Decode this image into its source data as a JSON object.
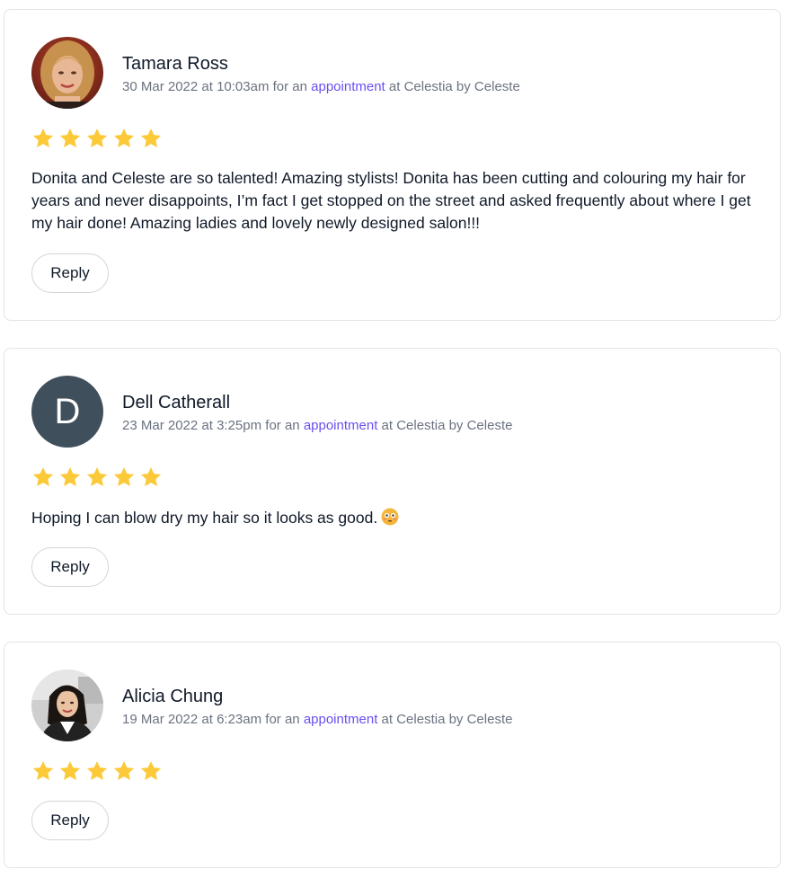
{
  "reviews": [
    {
      "name": "Tamara Ross",
      "avatar": {
        "type": "photo",
        "description_icon": "user-photo"
      },
      "date": "30 Mar 2022 at 10:03am",
      "for_text": " for an ",
      "link_text": "appointment",
      "at_text": " at Celestia by Celeste",
      "rating": 5,
      "text": "Donita and Celeste are so talented! Amazing stylists! Donita has been cutting and  colouring my hair for years and never disappoints, I’m fact I get  stopped on the street and asked frequently about where I get my hair done!  Amazing ladies and lovely newly designed salon!!!",
      "reply_label": "Reply"
    },
    {
      "name": "Dell Catherall",
      "avatar": {
        "type": "letter",
        "letter": "D",
        "bg": "#3f4f5b"
      },
      "date": "23 Mar 2022 at 3:25pm",
      "for_text": " for an ",
      "link_text": "appointment",
      "at_text": " at Celestia by Celeste",
      "rating": 5,
      "text": "Hoping I can blow dry my hair so it looks as good.",
      "emoji": "flushed-face-icon",
      "reply_label": "Reply"
    },
    {
      "name": "Alicia Chung",
      "avatar": {
        "type": "photo",
        "description_icon": "user-photo"
      },
      "date": "19 Mar 2022 at 6:23am",
      "for_text": " for an ",
      "link_text": "appointment",
      "at_text": " at Celestia by Celeste",
      "rating": 5,
      "reply_label": "Reply"
    }
  ],
  "colors": {
    "star": "#fcc938",
    "link": "#6950f3",
    "meta": "#6b7280",
    "border": "#e2e4e8",
    "text": "#101928"
  }
}
